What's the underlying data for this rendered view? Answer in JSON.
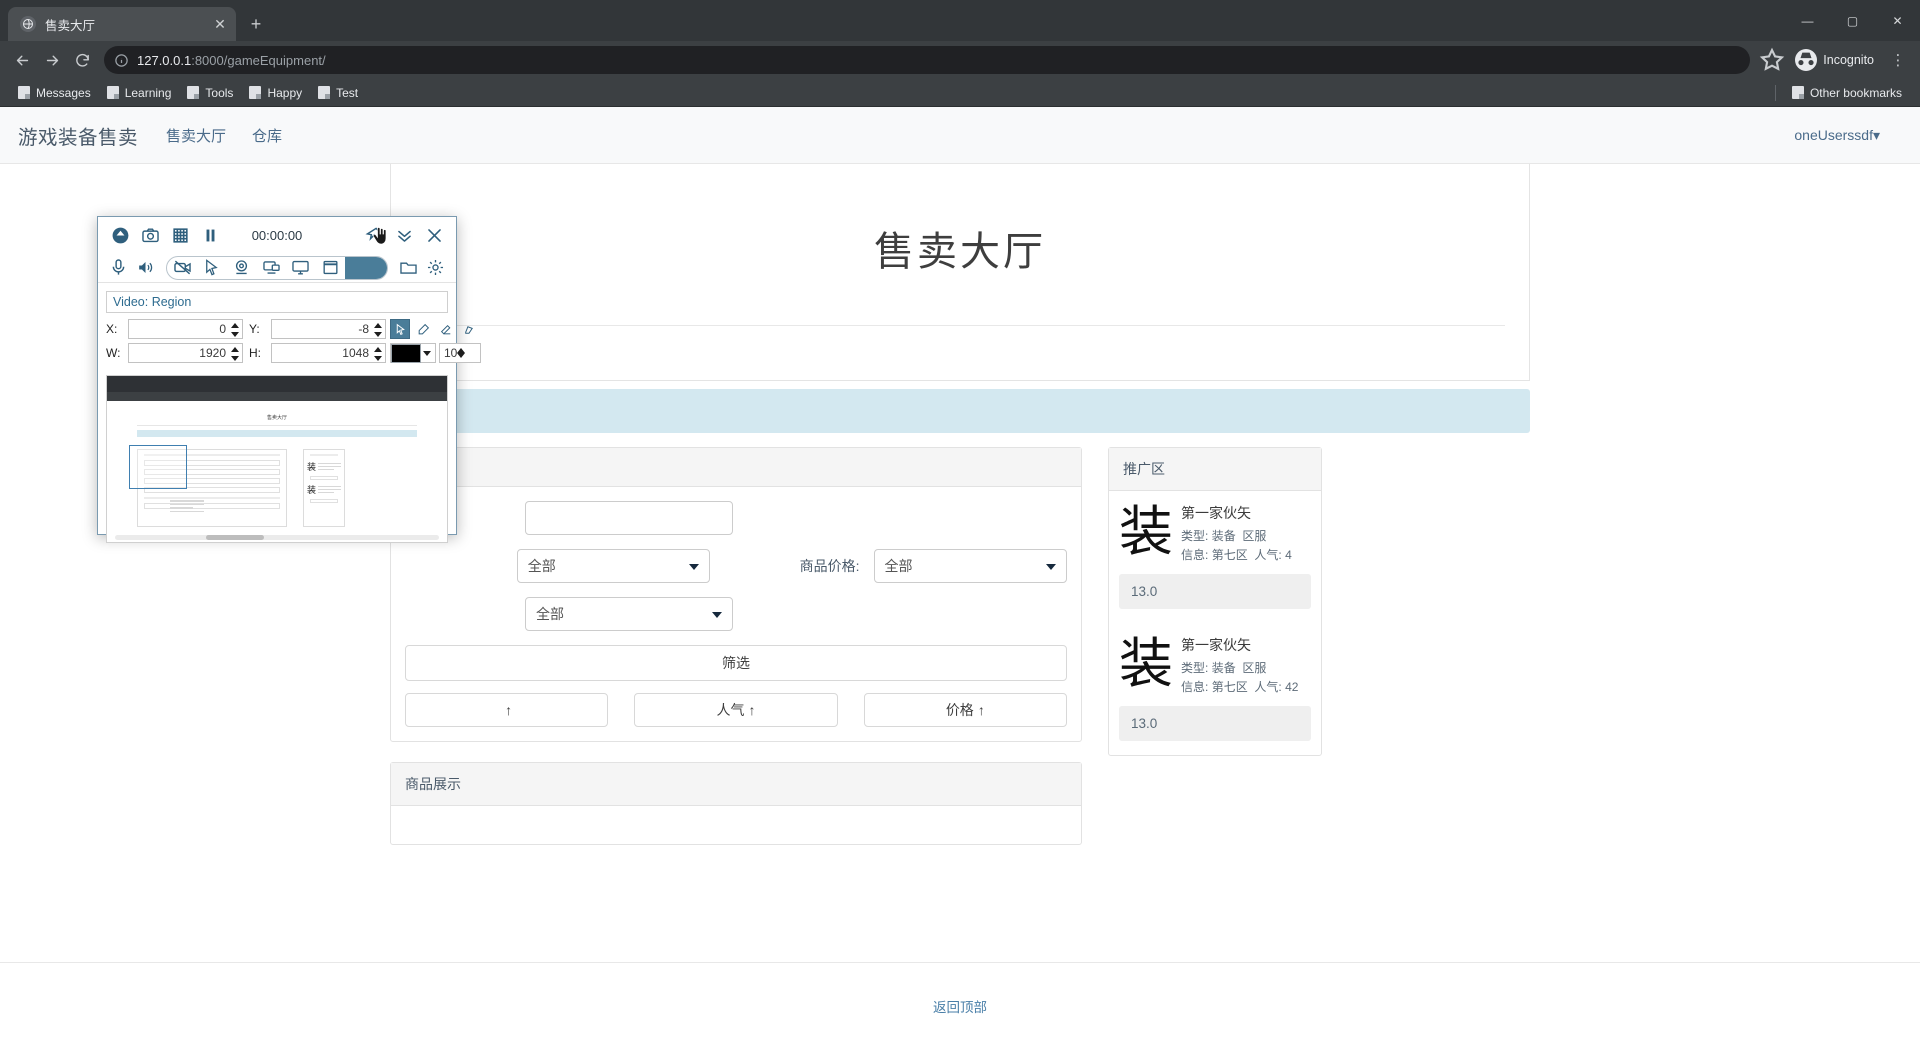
{
  "browser": {
    "tab": {
      "title": "售卖大厅",
      "favicon": "globe-icon",
      "close": "✕"
    },
    "newtab_label": "+",
    "window_controls": {
      "minimize": "—",
      "maximize": "▢",
      "close": "✕"
    },
    "nav": {
      "back": "←",
      "forward": "→",
      "reload": "⟳"
    },
    "omnibox": {
      "info_icon": "ⓘ",
      "url_host": "127.0.0.1",
      "url_rest": ":8000/gameEquipment/",
      "star": "☆"
    },
    "profile": {
      "label": "Incognito",
      "avatar_icon": "incognito-icon"
    },
    "menu": "⋮",
    "bookmarks": [
      {
        "label": "Messages"
      },
      {
        "label": "Learning"
      },
      {
        "label": "Tools"
      },
      {
        "label": "Happy"
      },
      {
        "label": "Test"
      }
    ],
    "other_bookmarks": "Other bookmarks"
  },
  "site": {
    "navbar": {
      "brand": "游戏装备售卖",
      "links": [
        "售卖大厅",
        "仓库"
      ],
      "user": "oneUserssdf▾"
    },
    "page_title": "售卖大厅",
    "filter_panel": {
      "fields": [
        {
          "label": "",
          "value": "",
          "type": "text"
        },
        {
          "label": "商品价格:",
          "value": "全部",
          "type": "select"
        },
        {
          "label": "",
          "value": "全部",
          "type": "select"
        },
        {
          "label": "",
          "value": "全部",
          "type": "select"
        }
      ],
      "submit_label": "筛选",
      "sort_buttons": [
        {
          "label": "",
          "arrow": "↑"
        },
        {
          "label": "人气",
          "arrow": "↑"
        },
        {
          "label": "价格",
          "arrow": "↑"
        }
      ]
    },
    "display_panel": {
      "header": "商品展示"
    },
    "promo_panel": {
      "header": "推广区",
      "cards": [
        {
          "glyph": "装",
          "name": "第一家伙矢",
          "type_label": "类型:",
          "type_value": "装备",
          "server_label": "区服",
          "info_label": "信息:",
          "info_value": "第七区",
          "popularity_label": "人气:",
          "popularity_value": "4",
          "price": "13.0"
        },
        {
          "glyph": "装",
          "name": "第一家伙矢",
          "type_label": "类型:",
          "type_value": "装备",
          "server_label": "区服",
          "info_label": "信息:",
          "info_value": "第七区",
          "popularity_label": "人气:",
          "popularity_value": "42",
          "price": "13.0"
        }
      ]
    },
    "footer_link": "返回顶部"
  },
  "recorder": {
    "timer": "00:00:00",
    "toolbar_top": [
      {
        "name": "record-upload-icon"
      },
      {
        "name": "camera-icon"
      },
      {
        "name": "grid-icon"
      },
      {
        "name": "pause-icon"
      }
    ],
    "toolbar_top_right": [
      {
        "name": "pin-icon"
      },
      {
        "name": "chevron-double-down-icon"
      },
      {
        "name": "close-icon"
      }
    ],
    "toolbar_mid": [
      {
        "name": "microphone-icon"
      },
      {
        "name": "speaker-icon"
      },
      {
        "name": "webcam-off-icon"
      },
      {
        "name": "cursor-icon"
      },
      {
        "name": "webcam-icon"
      },
      {
        "name": "screen-cast-icon"
      },
      {
        "name": "monitor-icon"
      },
      {
        "name": "region-icon"
      },
      {
        "name": "folder-icon"
      },
      {
        "name": "settings-gear-icon"
      }
    ],
    "mode_label": "Video: Region",
    "fields": {
      "x_label": "X:",
      "x_value": "0",
      "y_label": "Y:",
      "y_value": "-8",
      "w_label": "W:",
      "w_value": "1920",
      "h_label": "H:",
      "h_value": "1048"
    },
    "draw_tools": [
      {
        "name": "select-tool-icon",
        "selected": true
      },
      {
        "name": "pen-tool-icon",
        "selected": false
      },
      {
        "name": "eraser-tool-icon",
        "selected": false
      },
      {
        "name": "highlighter-tool-icon",
        "selected": false
      }
    ],
    "color_swatch": "#000000",
    "stroke_size": "10",
    "preview_title": "售卖大厅"
  },
  "colors": {
    "accent": "#4a7d99",
    "alert_band": "#d3e8f0",
    "chrome_dark": "#3c4043",
    "link": "#4a7fa8"
  }
}
